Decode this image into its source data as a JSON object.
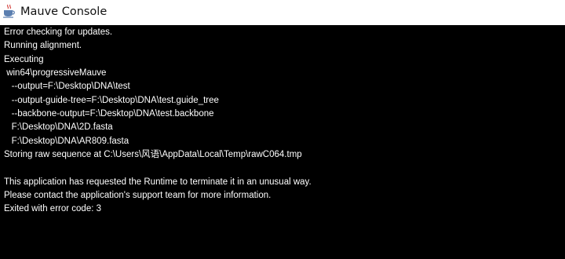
{
  "window": {
    "title": "Mauve Console",
    "icon": "java-cup-icon"
  },
  "console": {
    "lines": [
      "Error checking for updates.",
      "Running alignment.",
      "Executing",
      " win64\\progressiveMauve",
      "   --output=F:\\Desktop\\DNA\\test",
      "   --output-guide-tree=F:\\Desktop\\DNA\\test.guide_tree",
      "   --backbone-output=F:\\Desktop\\DNA\\test.backbone",
      "   F:\\Desktop\\DNA\\2D.fasta",
      "   F:\\Desktop\\DNA\\AR809.fasta",
      "Storing raw sequence at C:\\Users\\风语\\AppData\\Local\\Temp\\rawC064.tmp",
      "",
      "This application has requested the Runtime to terminate it in an unusual way.",
      "Please contact the application's support team for more information.",
      "Exited with error code: 3"
    ]
  },
  "colors": {
    "console_background": "#000000",
    "console_text": "#ffffff",
    "titlebar_background": "#ffffff"
  }
}
